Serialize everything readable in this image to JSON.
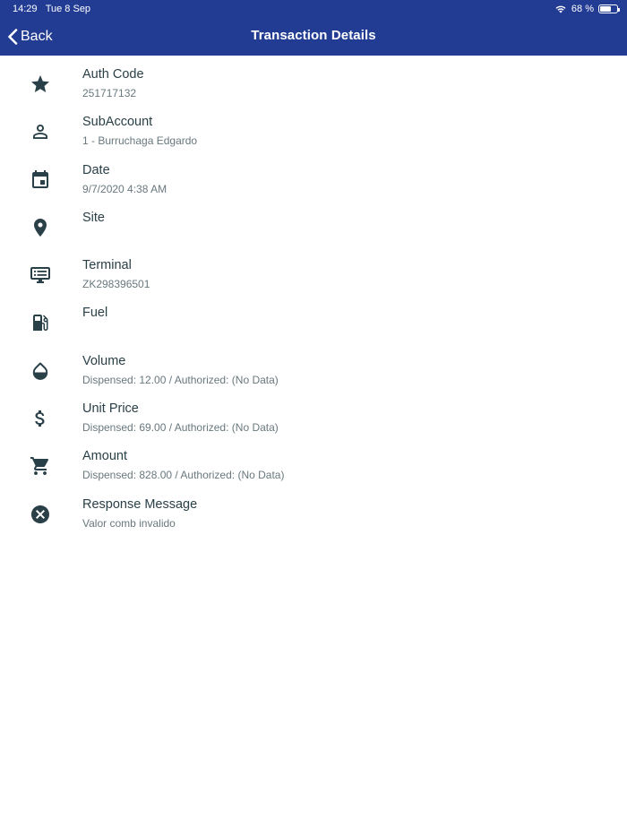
{
  "status_bar": {
    "time": "14:29",
    "date": "Tue 8 Sep",
    "battery_percent_text": "68 %",
    "battery_level": 0.68
  },
  "nav": {
    "back_label": "Back",
    "title": "Transaction Details"
  },
  "colors": {
    "nav_bg": "#223c93",
    "label": "#2a4048",
    "value": "#68787e"
  },
  "details": [
    {
      "icon": "star-icon",
      "label": "Auth Code",
      "value": "251717132"
    },
    {
      "icon": "person-icon",
      "label": "SubAccount",
      "value": "1 - Burruchaga Edgardo"
    },
    {
      "icon": "calendar-icon",
      "label": "Date",
      "value": "9/7/2020  4:38 AM"
    },
    {
      "icon": "location-pin-icon",
      "label": "Site",
      "value": ""
    },
    {
      "icon": "terminal-icon",
      "label": "Terminal",
      "value": "ZK298396501"
    },
    {
      "icon": "fuel-pump-icon",
      "label": "Fuel",
      "value": ""
    },
    {
      "icon": "drop-icon",
      "label": "Volume",
      "value": "Dispensed: 12.00 / Authorized: (No Data)"
    },
    {
      "icon": "dollar-icon",
      "label": "Unit Price",
      "value": "Dispensed: 69.00 / Authorized: (No Data)"
    },
    {
      "icon": "cart-icon",
      "label": "Amount",
      "value": "Dispensed: 828.00 / Authorized: (No Data)"
    },
    {
      "icon": "cancel-circle-icon",
      "label": "Response Message",
      "value": "Valor comb invalido"
    }
  ]
}
